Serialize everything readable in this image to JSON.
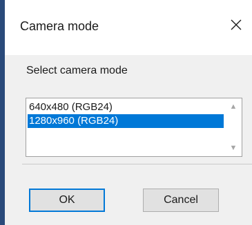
{
  "dialog": {
    "title": "Camera mode",
    "close_glyph": "close-icon",
    "prompt": "Select camera mode",
    "modes": [
      {
        "label": "640x480 (RGB24)",
        "selected": false
      },
      {
        "label": "1280x960 (RGB24)",
        "selected": true
      }
    ],
    "scroll_up": "▲",
    "scroll_down": "▼",
    "ok_label": "OK",
    "cancel_label": "Cancel"
  },
  "colors": {
    "selection": "#0078d7",
    "window_edge": "#2a4a7a",
    "body_background": "#f0f0f0"
  }
}
